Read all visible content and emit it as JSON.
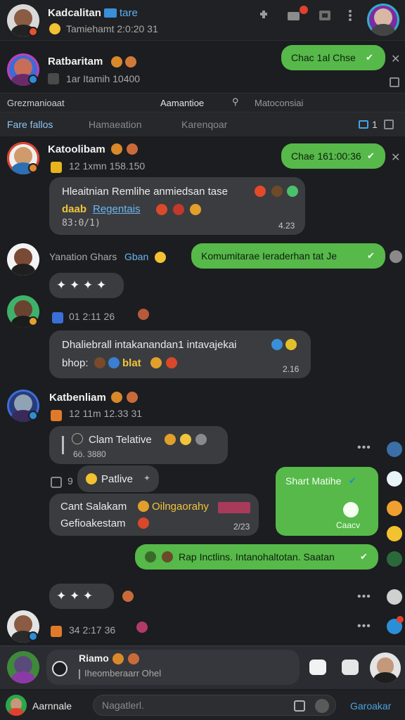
{
  "header": {
    "title": "Kadcalitan",
    "title_tag": "tare",
    "subtitle": "Tamiehamt 2:0:20 31"
  },
  "chat_top": {
    "name": "Ratbaritam",
    "meta": "1ar Itamih 10400",
    "out_text": "Chac 1al Chse"
  },
  "tabs_row1": [
    "Grezmanioaat",
    "Aamantioe",
    "Matoconsiai"
  ],
  "tabs_row2": [
    "Fare fallos",
    "Hamaeation",
    "Karenqoar"
  ],
  "tabs_count": "1",
  "messages": {
    "m1": {
      "name": "Katoolibam",
      "meta": "12 1xmn 158.150",
      "out_text": "Chae 161:00:36",
      "bubble_text": "Hleaitnian Remlihe anmiedsan tase",
      "bubble_tag": "daab",
      "bubble_link": "Regentais",
      "bubble_code": "83:0/1)",
      "bubble_time": "4.23"
    },
    "m2": {
      "meta_a": "Yanation Ghars",
      "meta_b": "Gban",
      "out_text": "Komumitarae Ieraderhan tat Je"
    },
    "m3": {
      "meta": "01 2:11 26",
      "bubble_line1": "Dhaliebrall intakanandan1 intavajekai",
      "bubble_line2a": "bhop:",
      "bubble_line2b": "blat",
      "bubble_time": "2.16"
    },
    "m4": {
      "name": "Katbenliam",
      "meta": "12 11m 12.33 31",
      "quote_title": "Clam Telative",
      "quote_sub": "6ö. 3880",
      "pill_num": "9",
      "pill_text": "Patlive",
      "out_card_title": "Shart Matihe",
      "out_card_sub": "Caacv",
      "in_line1a": "Cant Salakam",
      "in_line1b": "Oilngaorahy",
      "in_line2": "Gefioakestam",
      "in_time": "2/23",
      "out_long": "Rap Inctlins. Intanohaltotan. Saatan"
    },
    "m5": {
      "meta": "34 2:17 36"
    }
  },
  "reply_bar": {
    "name": "Riamo",
    "quote": "Iheomberaarr Ohel"
  },
  "composer": {
    "user_label": "Aarnnale",
    "placeholder": "Nagatlerl.",
    "send_label": "Garoakar"
  },
  "colors": {
    "bg": "#1c1d20",
    "bubble_in": "#3b3c40",
    "bubble_out": "#56b94a",
    "accent_blue": "#4aa3df",
    "badge_red": "#e0402e"
  }
}
